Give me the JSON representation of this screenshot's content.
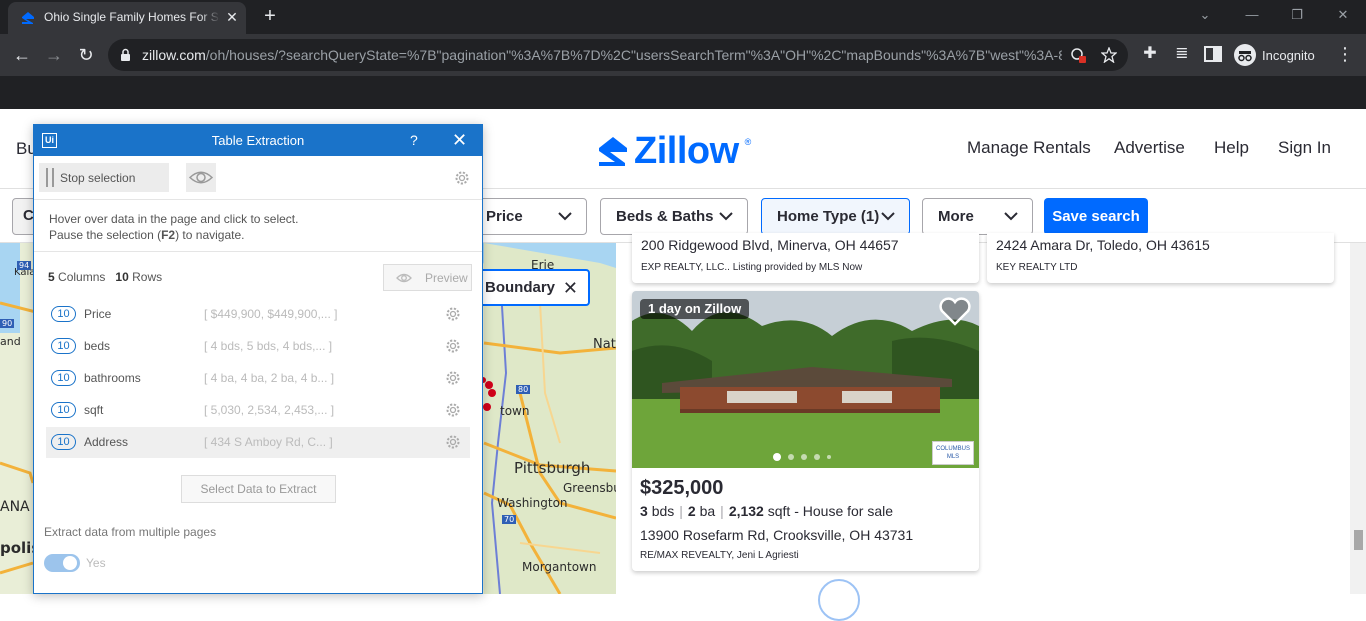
{
  "browser": {
    "tab_title": "Ohio Single Family Homes For Sale",
    "url_host": "zillow.com",
    "url_path": "/oh/houses/?searchQueryState=%7B\"pagination\"%3A%7B%7D%2C\"usersSearchTerm\"%3A\"OH\"%2C\"mapBounds\"%3A%7B\"west\"%3A-8...",
    "incognito_label": "Incognito"
  },
  "zillow": {
    "header": {
      "buy_stub": "Bu",
      "logo_text": "Zillow",
      "logo_reg": "®",
      "nav": [
        "Manage Rentals",
        "Advertise",
        "Help",
        "Sign In"
      ]
    },
    "filters": {
      "c_stub": "C",
      "price": "Price",
      "beds_baths": "Beds & Baths",
      "home_type": "Home Type (1)",
      "more": "More",
      "save_search": "Save search"
    },
    "map": {
      "labels": {
        "erie": "Erie",
        "nat": "Nat",
        "town": "town",
        "pittsburgh": "Pittsburgh",
        "greensburg": "Greensbur",
        "washington": "Washington",
        "morgantown": "Morgantown",
        "kala": "Kala",
        "ana": "ANA",
        "polis": "polis",
        "and": "and",
        "i94": "94",
        "i90": "90",
        "i80": "80",
        "i70": "70"
      },
      "boundary_label": "Boundary"
    },
    "listings": {
      "partial": [
        {
          "address": "200 Ridgewood Blvd, Minerva, OH 44657",
          "broker": "EXP REALTY, LLC.. Listing provided by MLS Now"
        },
        {
          "address": "2424 Amara Dr, Toledo, OH 43615",
          "broker": "KEY REALTY LTD"
        }
      ],
      "main": {
        "badge": "1 day on Zillow",
        "price": "$325,000",
        "beds": "3",
        "beds_unit": "bds",
        "baths": "2",
        "baths_unit": "ba",
        "sqft": "2,132",
        "sqft_unit": "sqft - House for sale",
        "address": "13900 Rosefarm Rd, Crooksville, OH 43731",
        "broker": "RE/MAX REVEALTY, Jeni L Agriesti",
        "mls_logo": "COLUMBUS MLS"
      }
    }
  },
  "extraction_panel": {
    "logo": "Ui",
    "title": "Table Extraction",
    "help": "?",
    "stop_selection": "Stop selection",
    "hint_line1": "Hover over data in the page and click to select.",
    "hint_line2_a": "Pause the selection (",
    "hint_line2_key": "F2",
    "hint_line2_b": ") to navigate.",
    "columns_count": "5",
    "columns_label": "Columns",
    "rows_count": "10",
    "rows_label": "Rows",
    "preview": "Preview",
    "columns": [
      {
        "count": "10",
        "name": "Price",
        "values": "[ $449,900, $449,900,... ]"
      },
      {
        "count": "10",
        "name": "beds",
        "values": "[ 4 bds, 5 bds, 4 bds,... ]"
      },
      {
        "count": "10",
        "name": "bathrooms",
        "values": "[ 4 ba, 4 ba, 2 ba, 4 b... ]"
      },
      {
        "count": "10",
        "name": "sqft",
        "values": "[ 5,030, 2,534, 2,453,... ]"
      },
      {
        "count": "10",
        "name": "Address",
        "values": "[ 434 S Amboy Rd, C... ]"
      }
    ],
    "select_data": "Select Data to Extract",
    "multi_pages": "Extract data from multiple pages",
    "toggle_label": "Yes"
  },
  "colors": {
    "zillow_blue": "#006aff",
    "uipath_blue": "#1a73c9",
    "chrome_dark": "#202124",
    "chrome_toolbar": "#35363a"
  }
}
